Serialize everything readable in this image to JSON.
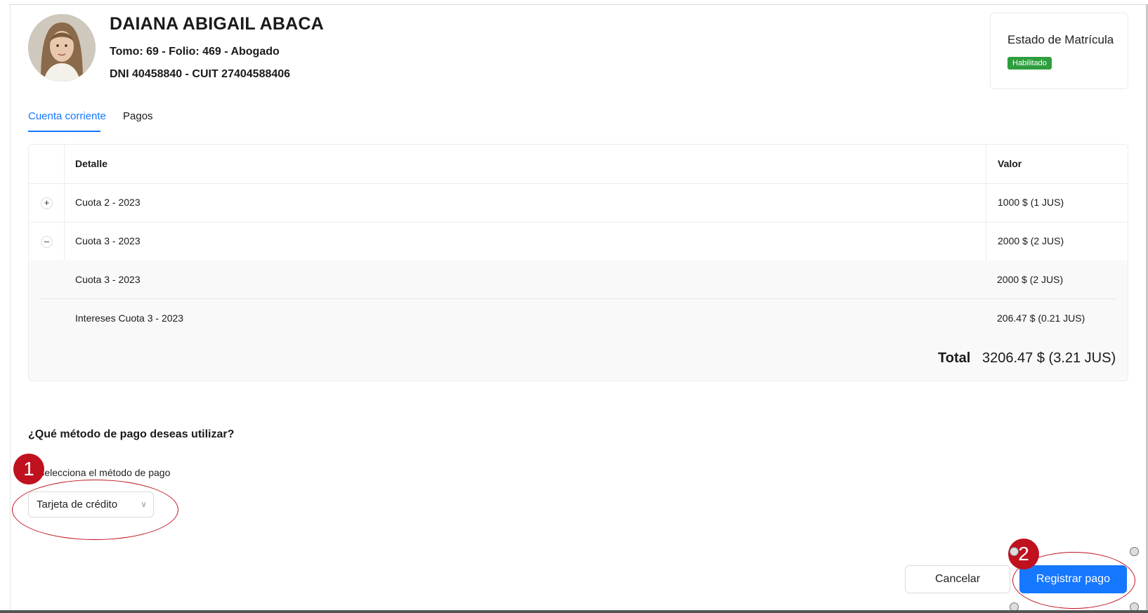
{
  "profile": {
    "name": "DAIANA ABIGAIL ABACA",
    "line1": "Tomo: 69 - Folio: 469 - Abogado",
    "line2": "DNI 40458840 - CUIT 27404588406"
  },
  "status": {
    "title": "Estado de Matrícula",
    "badge": "Habilitado",
    "badge_color": "#2e9e3e"
  },
  "tabs": [
    {
      "label": "Cuenta corriente",
      "active": true
    },
    {
      "label": "Pagos",
      "active": false
    }
  ],
  "table": {
    "headers": {
      "detail": "Detalle",
      "value": "Valor"
    },
    "rows": [
      {
        "expander": "+",
        "detail": "Cuota 2 - 2023",
        "value": "1000 $ (1 JUS)"
      },
      {
        "expander": "–",
        "detail": "Cuota 3 - 2023",
        "value": "2000 $ (2 JUS)"
      }
    ],
    "subrows": [
      {
        "detail": "Cuota 3 - 2023",
        "value": "2000 $ (2 JUS)"
      },
      {
        "detail": "Intereses Cuota 3 - 2023",
        "value": "206.47 $ (0.21 JUS)"
      }
    ],
    "total_label": "Total",
    "total_value": "3206.47 $ (3.21 JUS)"
  },
  "payment": {
    "question": "¿Qué método de pago deseas utilizar?",
    "select_label": "Selecciona el método de pago",
    "selected": "Tarjeta de crédito"
  },
  "buttons": {
    "cancel": "Cancelar",
    "submit": "Registrar pago"
  },
  "annotations": [
    "1",
    "2"
  ],
  "colors": {
    "accent": "#1677ff",
    "annotation": "#c0111f"
  }
}
